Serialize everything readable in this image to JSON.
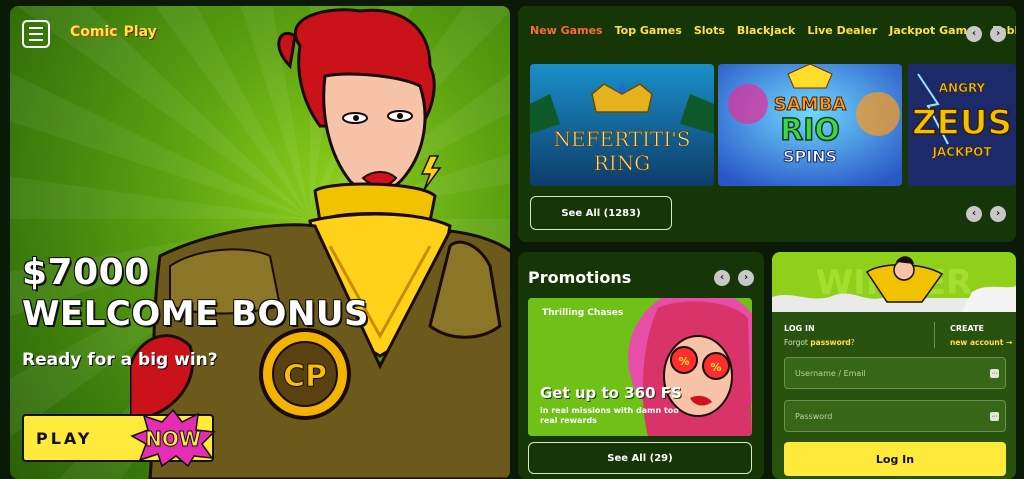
{
  "brand": {
    "word1": "Comic",
    "word2": "Play"
  },
  "hero": {
    "amount": "$7000",
    "title": "WELCOME BONUS",
    "subtitle": "Ready for a big win?",
    "play_label": "PLAY",
    "now_label": "NOW",
    "badge_text": "CP"
  },
  "games": {
    "tabs": [
      "New Games",
      "Top Games",
      "Slots",
      "Blackjack",
      "Live Dealer",
      "Jackpot Games",
      "Table G"
    ],
    "active_tab": 0,
    "tiles": [
      {
        "title_top": "NEFERTITI'S",
        "title_bottom": "RING"
      },
      {
        "title_top": "SAMBA",
        "title_mid": "RIO",
        "title_bottom": "SPINS"
      },
      {
        "title_top": "ANGRY",
        "title_mid": "ZEUS",
        "title_bottom": "JACKPOT"
      }
    ],
    "see_all": "See All (1283)"
  },
  "promotions": {
    "title": "Promotions",
    "card_label": "Thrilling Chases",
    "headline": "Get up to 360 FS",
    "description": "in real missions with damn too real rewards",
    "see_all": "See All (29)"
  },
  "login": {
    "banner_text": "WINNER",
    "login_head": "LOG IN",
    "forgot_prefix": "Forgot",
    "forgot_link": "password",
    "forgot_suffix": "?",
    "create_head": "CREATE",
    "new_account": "new account →",
    "username_placeholder": "Username / Email",
    "password_placeholder": "Password",
    "submit": "Log In"
  },
  "colors": {
    "accent_yellow": "#ffe93a",
    "active_tab": "#ff6a3a",
    "panel_green": "#173608"
  }
}
